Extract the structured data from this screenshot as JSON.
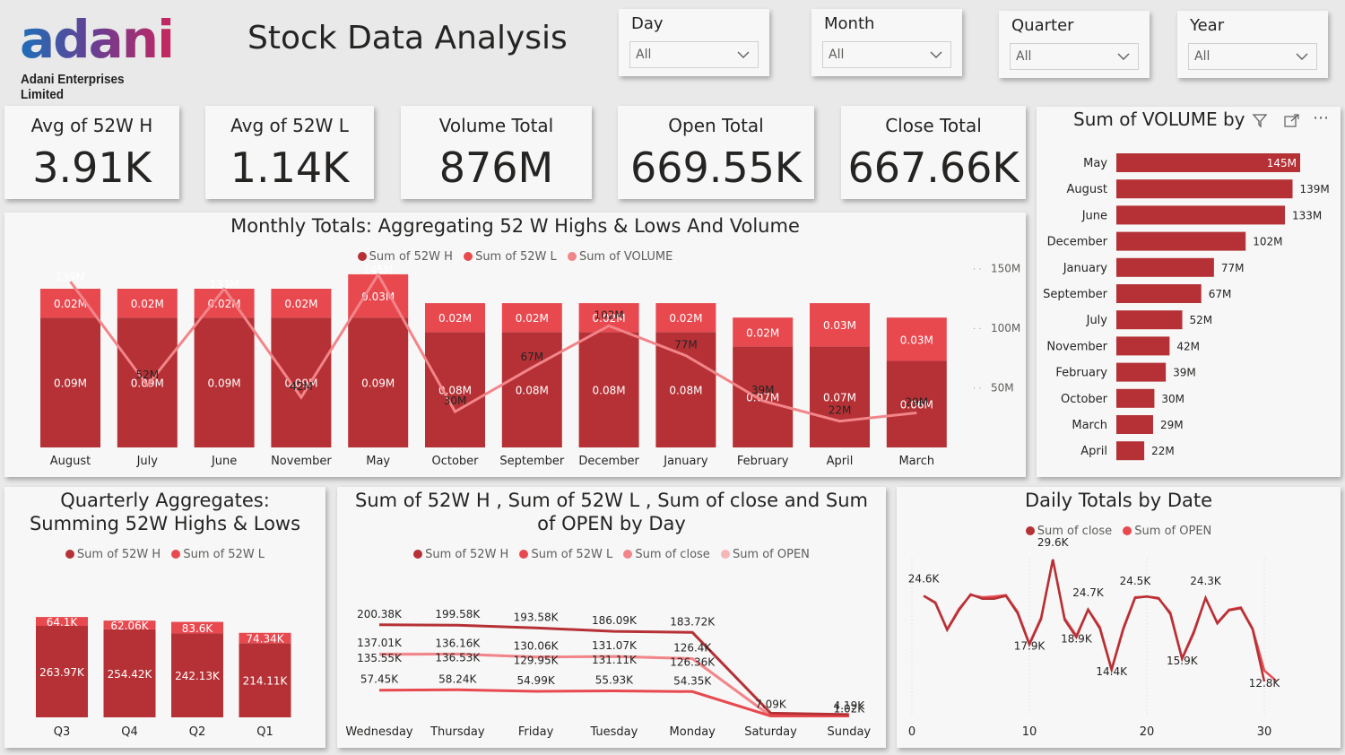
{
  "header": {
    "logo_text": "adani",
    "logo_sub": "Adani Enterprises Limited",
    "title": "Stock Data Analysis"
  },
  "slicers": [
    {
      "label": "Day",
      "value": "All"
    },
    {
      "label": "Month",
      "value": "All"
    },
    {
      "label": "Quarter",
      "value": "All"
    },
    {
      "label": "Year",
      "value": "All"
    }
  ],
  "kpis": [
    {
      "label": "Avg of 52W H",
      "value": "3.91K"
    },
    {
      "label": "Avg of 52W L",
      "value": "1.14K"
    },
    {
      "label": "Volume Total",
      "value": "876M"
    },
    {
      "label": "Open Total",
      "value": "669.55K"
    },
    {
      "label": "Close Total",
      "value": "667.66K"
    }
  ],
  "colors": {
    "dark": "#b53136",
    "mid": "#e8494f",
    "light": "#f28589",
    "pale": "#f6b6b8"
  },
  "chart_data": [
    {
      "type": "bar",
      "id": "monthly",
      "title": "Monthly Totals: Aggregating 52 W Highs & Lows And Volume",
      "categories": [
        "August",
        "July",
        "June",
        "November",
        "May",
        "October",
        "September",
        "December",
        "January",
        "February",
        "April",
        "March"
      ],
      "series": [
        {
          "name": "Sum of 52W H",
          "values": [
            0.09,
            0.09,
            0.09,
            0.09,
            0.09,
            0.08,
            0.08,
            0.08,
            0.08,
            0.07,
            0.07,
            0.06
          ],
          "labels": [
            "0.09M",
            "0.09M",
            "0.09M",
            "0.09M",
            "0.09M",
            "0.08M",
            "0.08M",
            "0.08M",
            "0.08M",
            "0.07M",
            "0.07M",
            "0.06M"
          ],
          "unit": "M"
        },
        {
          "name": "Sum of 52W L",
          "values": [
            0.02,
            0.02,
            0.02,
            0.02,
            0.03,
            0.02,
            0.02,
            0.02,
            0.02,
            0.02,
            0.03,
            0.03
          ],
          "labels": [
            "0.02M",
            "0.02M",
            "0.02M",
            "0.02M",
            "0.03M",
            "0.02M",
            "0.02M",
            "0.02M",
            "0.02M",
            "0.02M",
            "0.03M",
            "0.03M"
          ],
          "unit": "M"
        },
        {
          "name": "Sum of VOLUME",
          "values": [
            139,
            52,
            133,
            42,
            145,
            30,
            67,
            102,
            77,
            39,
            22,
            29
          ],
          "labels": [
            "139M",
            "52M",
            "133M",
            "42M",
            "145M",
            "30M",
            "67M",
            "102M",
            "77M",
            "39M",
            "22M",
            "29M"
          ],
          "unit": "M"
        }
      ],
      "y2_ticks": [
        "50M",
        "100M",
        "150M"
      ],
      "legend": "top-center"
    },
    {
      "type": "bar",
      "id": "volume_by_month",
      "title": "Sum of VOLUME by",
      "categories": [
        "May",
        "August",
        "June",
        "December",
        "January",
        "September",
        "July",
        "November",
        "February",
        "October",
        "March",
        "April"
      ],
      "values": [
        145,
        139,
        133,
        102,
        77,
        67,
        52,
        42,
        39,
        30,
        29,
        22
      ],
      "labels": [
        "145M",
        "139M",
        "133M",
        "102M",
        "77M",
        "67M",
        "52M",
        "42M",
        "39M",
        "30M",
        "29M",
        "22M"
      ]
    },
    {
      "type": "bar",
      "id": "quarterly",
      "title": "Quarterly Aggregates: Summing 52W Highs & Lows",
      "categories": [
        "Q3",
        "Q4",
        "Q2",
        "Q1"
      ],
      "series": [
        {
          "name": "Sum of 52W H",
          "values": [
            263.97,
            254.42,
            242.13,
            214.11
          ],
          "labels": [
            "263.97K",
            "254.42K",
            "242.13K",
            "214.11K"
          ]
        },
        {
          "name": "Sum of 52W L",
          "values": [
            64.1,
            62.06,
            83.6,
            74.34
          ],
          "labels": [
            "64.1K",
            "62.06K",
            "83.6K",
            "74.34K"
          ]
        }
      ],
      "legend": "top-center"
    },
    {
      "type": "line",
      "id": "by_day",
      "title": "Sum of 52W H , Sum of 52W L , Sum of close and Sum of OPEN by Day",
      "categories": [
        "Wednesday",
        "Thursday",
        "Friday",
        "Tuesday",
        "Monday",
        "Saturday",
        "Sunday"
      ],
      "series": [
        {
          "name": "Sum of 52W H",
          "values": [
            200.38,
            199.58,
            193.58,
            186.09,
            183.72,
            7.09,
            4.19
          ],
          "labels": [
            "200.38K",
            "199.58K",
            "193.58K",
            "186.09K",
            "183.72K",
            "7.09K",
            "4.19K"
          ]
        },
        {
          "name": "Sum of 52W L",
          "values": [
            57.45,
            58.24,
            54.99,
            55.93,
            54.35,
            1.02,
            1.02
          ],
          "labels": [
            "57.45K",
            "58.24K",
            "54.99K",
            "55.93K",
            "54.35K",
            "",
            ""
          ]
        },
        {
          "name": "Sum of close",
          "values": [
            135.55,
            136.53,
            129.95,
            131.11,
            126.36,
            1.02,
            1.02
          ],
          "labels": [
            "135.55K",
            "136.53K",
            "129.95K",
            "131.11K",
            "126.36K",
            "",
            "1.02K"
          ]
        },
        {
          "name": "Sum of OPEN",
          "values": [
            137.01,
            136.16,
            130.06,
            131.07,
            126.4,
            1.02,
            1.02
          ],
          "labels": [
            "137.01K",
            "136.16K",
            "130.06K",
            "131.07K",
            "126.4K",
            "",
            ""
          ]
        }
      ],
      "legend": "top-center"
    },
    {
      "type": "line",
      "id": "daily",
      "title": "Daily Totals by Date",
      "x": [
        1,
        2,
        3,
        4,
        5,
        6,
        7,
        8,
        9,
        10,
        11,
        12,
        13,
        14,
        15,
        16,
        17,
        18,
        19,
        20,
        21,
        22,
        23,
        24,
        25,
        26,
        27,
        28,
        29,
        30,
        31
      ],
      "series": [
        {
          "name": "Sum of close",
          "values": [
            24.6,
            23.6,
            19.9,
            22.6,
            24.8,
            24.2,
            24.2,
            24.6,
            22.2,
            17.9,
            21.4,
            29.6,
            21.3,
            18.9,
            22.7,
            20.1,
            14.4,
            20.0,
            24.3,
            24.5,
            24.3,
            22.1,
            15.9,
            19.5,
            24.3,
            20.8,
            22.6,
            22.9,
            20.0,
            12.8,
            null
          ]
        },
        {
          "name": "Sum of OPEN",
          "values": [
            24.6,
            23.7,
            20.0,
            22.8,
            24.7,
            24.4,
            24.5,
            24.7,
            22.4,
            18.0,
            21.6,
            29.6,
            21.5,
            19.1,
            22.7,
            20.3,
            14.5,
            20.2,
            24.4,
            24.5,
            24.2,
            22.3,
            16.0,
            19.7,
            24.3,
            20.9,
            22.7,
            23.0,
            20.1,
            14.3,
            12.9
          ]
        }
      ],
      "point_labels": [
        {
          "x": 1,
          "text": "24.6K"
        },
        {
          "x": 10,
          "text": "17.9K"
        },
        {
          "x": 12,
          "text": "29.6K"
        },
        {
          "x": 14,
          "text": "18.9K"
        },
        {
          "x": 15,
          "text": "24.7K"
        },
        {
          "x": 17,
          "text": "14.4K"
        },
        {
          "x": 19,
          "text": "24.5K"
        },
        {
          "x": 23,
          "text": "15.9K"
        },
        {
          "x": 25,
          "text": "24.3K"
        },
        {
          "x": 30,
          "text": "12.8K"
        }
      ],
      "x_ticks": [
        0,
        10,
        20,
        30
      ],
      "xlim": [
        0,
        31
      ],
      "ylim": [
        11,
        31
      ],
      "legend": "top-center"
    }
  ]
}
